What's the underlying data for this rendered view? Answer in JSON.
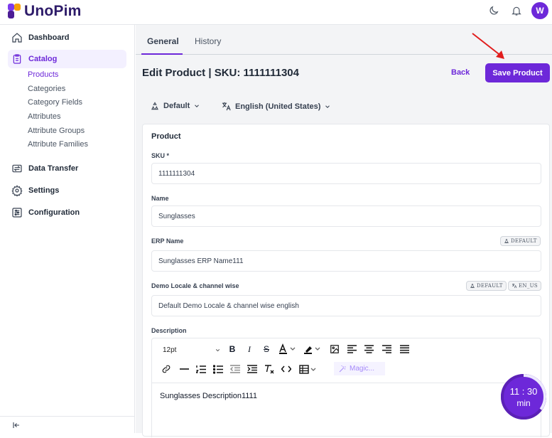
{
  "app": {
    "name": "UnoPim"
  },
  "header": {
    "avatar_initial": "W"
  },
  "sidebar": {
    "items": [
      {
        "label": "Dashboard"
      },
      {
        "label": "Catalog"
      },
      {
        "label": "Data Transfer"
      },
      {
        "label": "Settings"
      },
      {
        "label": "Configuration"
      }
    ],
    "catalog_sub": [
      "Products",
      "Categories",
      "Category Fields",
      "Attributes",
      "Attribute Groups",
      "Attribute Families"
    ]
  },
  "tabs": [
    "General",
    "History"
  ],
  "page": {
    "title": "Edit Product | SKU: 1111111304",
    "back_label": "Back",
    "save_label": "Save Product"
  },
  "selectors": {
    "channel": "Default",
    "locale": "English (United States)"
  },
  "card": {
    "title": "Product",
    "fields": {
      "sku": {
        "label": "SKU *",
        "value": "1111111304"
      },
      "name": {
        "label": "Name",
        "value": "Sunglasses"
      },
      "erp": {
        "label": "ERP Name",
        "value": "Sunglasses ERP Name111",
        "badge": "DEFAULT"
      },
      "demo": {
        "label": "Demo Locale & channel wise",
        "value": "Default Demo Locale & channel wise english",
        "badge_channel": "DEFAULT",
        "badge_locale": "EN_US"
      },
      "description": {
        "label": "Description",
        "value": "Sunglasses Description1111"
      }
    }
  },
  "editor": {
    "font_size": "12pt",
    "magic_label": "Magic..."
  },
  "timer": {
    "time": "11 : 30",
    "unit": "min",
    "progress": 0.35
  },
  "colors": {
    "accent": "#6d28d9",
    "annotation_arrow": "#e11d1d"
  }
}
